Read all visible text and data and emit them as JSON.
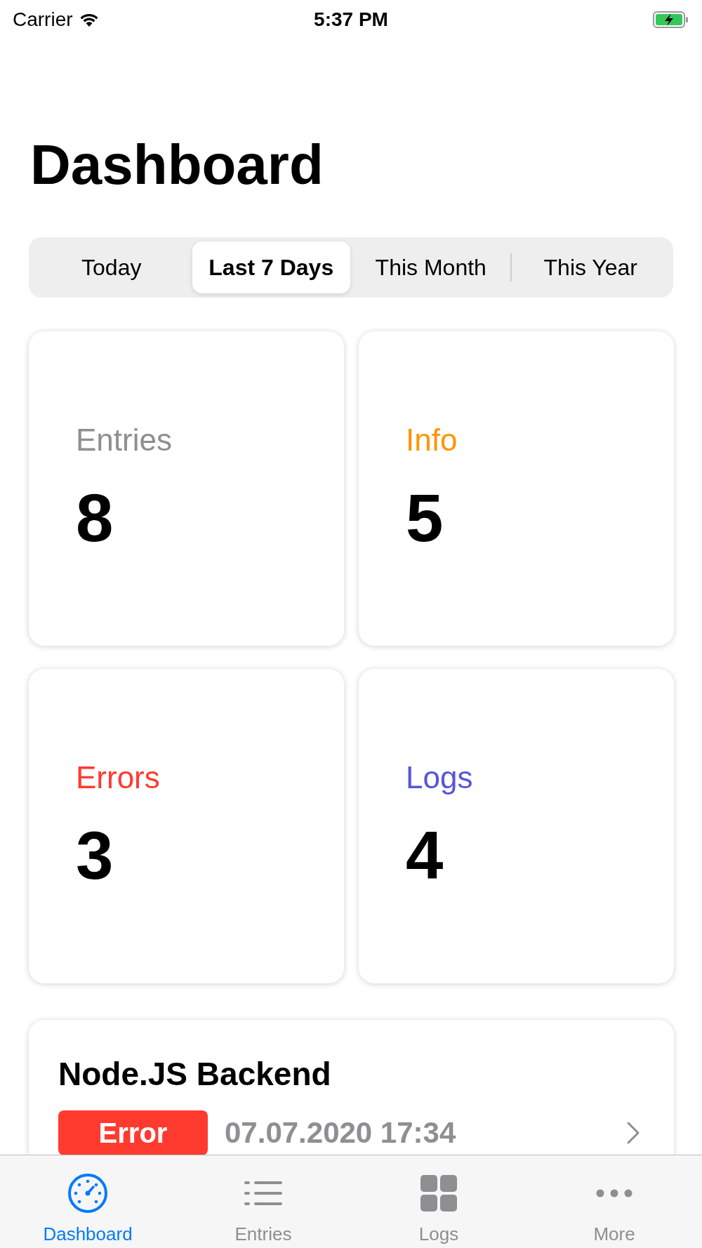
{
  "status_bar": {
    "carrier": "Carrier",
    "time": "5:37 PM"
  },
  "title": "Dashboard",
  "segments": [
    {
      "label": "Today",
      "selected": false
    },
    {
      "label": "Last 7 Days",
      "selected": true
    },
    {
      "label": "This Month",
      "selected": false
    },
    {
      "label": "This Year",
      "selected": false
    }
  ],
  "stats": [
    {
      "label": "Entries",
      "value": "8",
      "color": "#8e8e93"
    },
    {
      "label": "Info",
      "value": "5",
      "color": "#ff9500"
    },
    {
      "label": "Errors",
      "value": "3",
      "color": "#ff3b30"
    },
    {
      "label": "Logs",
      "value": "4",
      "color": "#5856d6"
    }
  ],
  "recent": {
    "title": "Node.JS Backend",
    "badge": "Error",
    "timestamp": "07.07.2020 17:34"
  },
  "tab_bar": [
    {
      "label": "Dashboard",
      "selected": true
    },
    {
      "label": "Entries",
      "selected": false
    },
    {
      "label": "Logs",
      "selected": false
    },
    {
      "label": "More",
      "selected": false
    }
  ]
}
